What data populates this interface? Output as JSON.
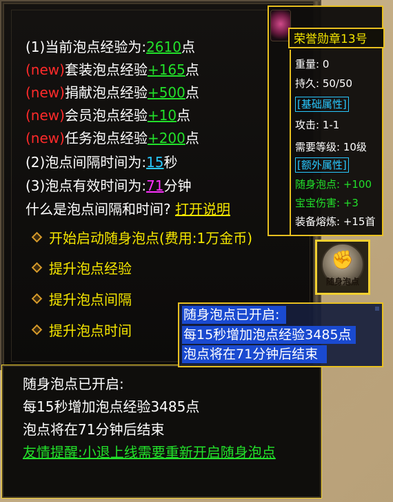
{
  "panel": {
    "stats": {
      "line1": {
        "prefix": "(1)当前泡点经验为:",
        "value": "2610",
        "suffix": "点"
      },
      "line2": {
        "tag": "(new)",
        "label": "套装泡点经验",
        "value": "+165",
        "suffix": "点"
      },
      "line3": {
        "tag": "(new)",
        "label": "捐献泡点经验",
        "value": "+500",
        "suffix": "点"
      },
      "line4": {
        "tag": "(new)",
        "label": "会员泡点经验",
        "value": "+10",
        "suffix": "点"
      },
      "line5": {
        "tag": "(new)",
        "label": "任务泡点经验",
        "value": "+200",
        "suffix": "点"
      },
      "line6": {
        "prefix": "(2)泡点间隔时间为:",
        "value": "15",
        "suffix": "秒"
      },
      "line7": {
        "prefix": "(3)泡点有效时间为:",
        "value": "71",
        "suffix": "分钟"
      },
      "line8": {
        "prefix": "什么是泡点间隔和时间?",
        "link": "打开说明"
      }
    },
    "menu": [
      {
        "label": "开始启动随身泡点(费用:1万金币)"
      },
      {
        "label": "提升泡点经验"
      },
      {
        "label": "提升泡点间隔"
      },
      {
        "label": "提升泡点时间"
      }
    ]
  },
  "notice": {
    "line1": "随身泡点已开启:",
    "line2": "每15秒增加泡点经验3485点",
    "line3": "泡点将在71分钟后结束",
    "line4": "友情提醒:小退上线需要重新开启随身泡点"
  },
  "item_tooltip": {
    "title": "荣誉勋章13号",
    "weight": "重量: 0",
    "durability": "持久: 50/50",
    "base_header": "[基础属性]",
    "attack": "攻击: 1-1",
    "level_req": "需要等级: 10级",
    "extra_header": "[额外属性]",
    "extra1": "随身泡点: +100",
    "extra2": "宝宝伤害: +3",
    "smelt": "装备熔炼: +15首"
  },
  "badge": {
    "label": "随身泡点"
  },
  "popup": {
    "line1": "随身泡点已开启:",
    "line2": "每15秒增加泡点经验3485点",
    "line3": "泡点将在71分钟后结束"
  },
  "colors": {
    "panel_bg": "#0c0b0a",
    "highlight_yellow": "#f5e600",
    "value_green": "#22e02a",
    "tag_red": "#ff2a2a",
    "value_cyan": "#28c8ff",
    "value_magenta": "#ff30ff",
    "popup_highlight": "#1a4ad0",
    "gold_border": "#e8c020"
  },
  "icons": {
    "menu_bullet": "diamond-bullet-icon",
    "tooltip_item": "honor-medal-icon",
    "badge": "handshake-medal-icon"
  }
}
